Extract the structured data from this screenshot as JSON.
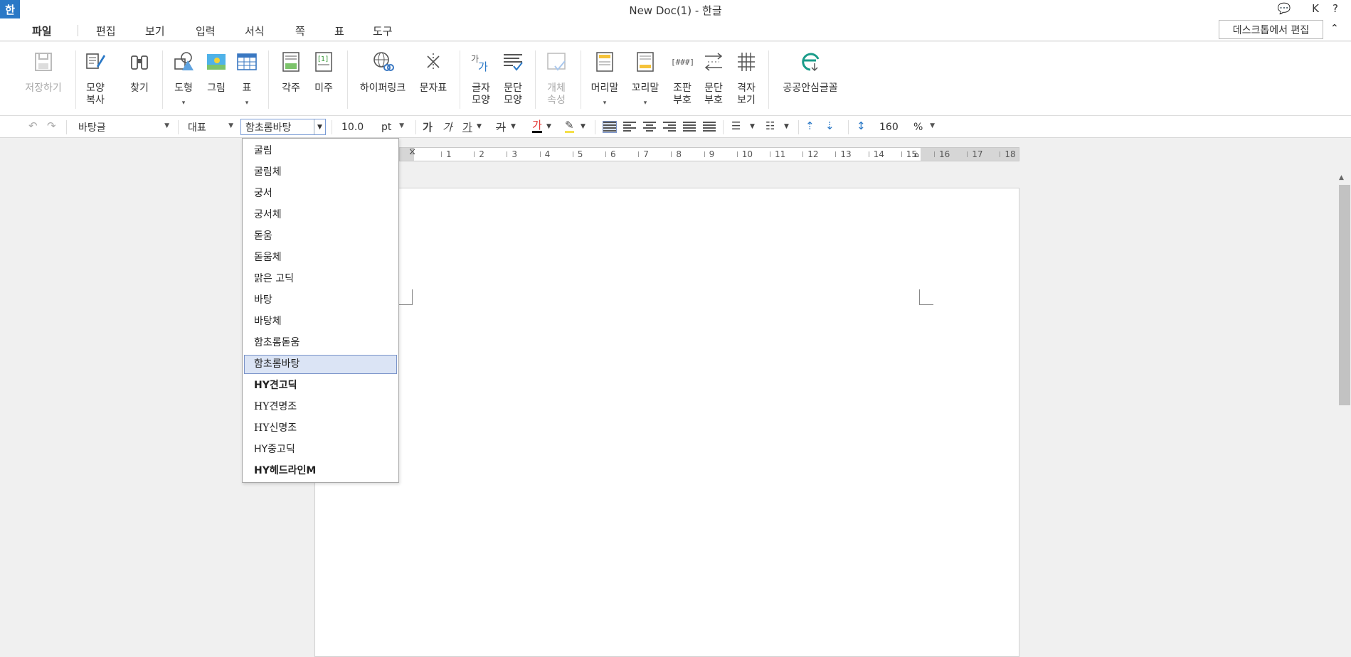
{
  "window": {
    "title": "New Doc(1) - 한글",
    "logo": "한"
  },
  "titlebar_icons": {
    "chat": "💬",
    "user": "K",
    "help": "?"
  },
  "menu": {
    "tabs": [
      "파일",
      "편집",
      "보기",
      "입력",
      "서식",
      "쪽",
      "표",
      "도구"
    ],
    "active": "파일"
  },
  "desktop_edit_label": "데스크톱에서 편집",
  "ribbon": {
    "save": "저장하기",
    "format_copy": "모양\n복사",
    "find": "찾기",
    "shape": "도형",
    "picture": "그림",
    "table": "표",
    "footnote": "각주",
    "endnote": "미주",
    "hyperlink": "하이퍼링크",
    "charmap": "문자표",
    "char_shape": "글자\n모양",
    "para_shape": "문단\n모양",
    "object_prop": "개체\n속성",
    "header": "머리말",
    "footer": "꼬리말",
    "layout_mark": "조판\n부호",
    "para_mark": "문단\n부호",
    "grid_view": "격자\n보기",
    "safe_font": "공공안심글꼴"
  },
  "format": {
    "style": "바탕글",
    "lang": "대표",
    "font": "함초롬바탕",
    "size": "10.0",
    "unit": "pt",
    "line_spacing": "160",
    "line_unit": "%",
    "char_bold": "가",
    "char_italic": "가",
    "char_underline": "가",
    "char_strike": "가",
    "font_color_glyph": "가"
  },
  "ruler_labels": [
    "1",
    "2",
    "3",
    "4",
    "5",
    "6",
    "7",
    "8",
    "9",
    "10",
    "11",
    "12",
    "13",
    "14",
    "15",
    "16",
    "17",
    "18"
  ],
  "font_list": [
    {
      "name": "굴림",
      "style": "normal"
    },
    {
      "name": "굴림체",
      "style": "normal"
    },
    {
      "name": "궁서",
      "style": "serif"
    },
    {
      "name": "궁서체",
      "style": "serif"
    },
    {
      "name": "돋움",
      "style": "normal"
    },
    {
      "name": "돋움체",
      "style": "normal"
    },
    {
      "name": "맑은 고딕",
      "style": "normal"
    },
    {
      "name": "바탕",
      "style": "serif"
    },
    {
      "name": "바탕체",
      "style": "serif"
    },
    {
      "name": "함초롬돋움",
      "style": "normal"
    },
    {
      "name": "함초롬바탕",
      "style": "selected"
    },
    {
      "name": "HY견고딕",
      "style": "bold"
    },
    {
      "name": "HY견명조",
      "style": "serif"
    },
    {
      "name": "HY신명조",
      "style": "serif"
    },
    {
      "name": "HY중고딕",
      "style": "normal"
    },
    {
      "name": "HY헤드라인M",
      "style": "bold"
    }
  ],
  "colors": {
    "accent": "#2a78c6",
    "selected_bg": "#dbe4f5",
    "font_color": "#e53935",
    "highlight": "#f5e04a"
  }
}
